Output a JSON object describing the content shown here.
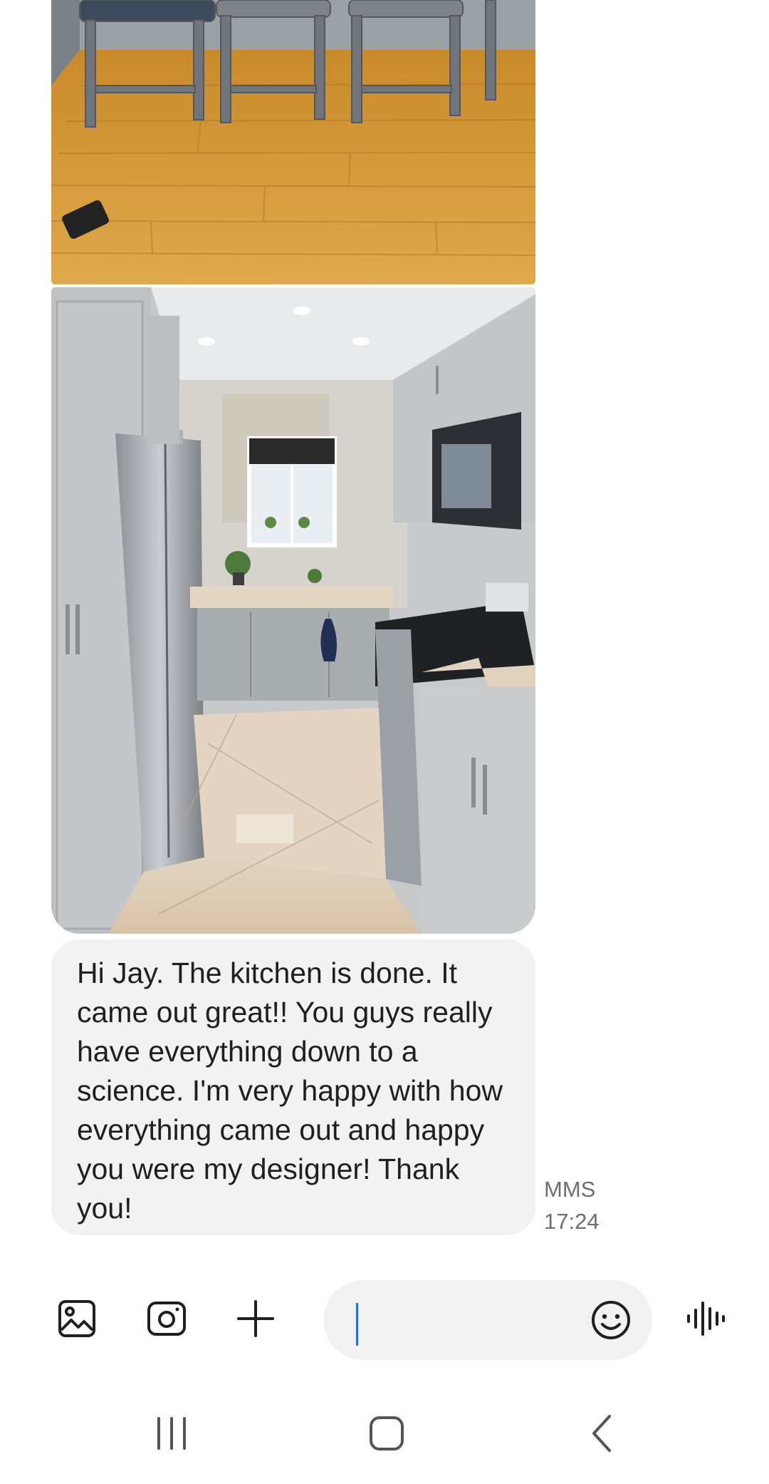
{
  "conversation": {
    "attachments": [
      {
        "type": "image",
        "description_icon": "photo-floor-stools"
      },
      {
        "type": "image",
        "description_icon": "photo-kitchen"
      }
    ],
    "message": {
      "text": "Hi Jay. The kitchen is done. It came out great!! You guys really have everything down to a science. I'm very happy with how everything came out and happy you were my designer! Thank you!",
      "type_label": "MMS",
      "time": "17:24"
    }
  },
  "composer": {
    "input_value": "",
    "icons": {
      "gallery": "gallery-icon",
      "camera": "camera-icon",
      "add": "plus-icon",
      "emoji": "emoji-icon",
      "voice": "voice-waveform-icon"
    },
    "accent_color": "#1a6cff"
  },
  "navbar": {
    "icons": {
      "recents": "recents-icon",
      "home": "home-icon",
      "back": "back-icon"
    }
  }
}
